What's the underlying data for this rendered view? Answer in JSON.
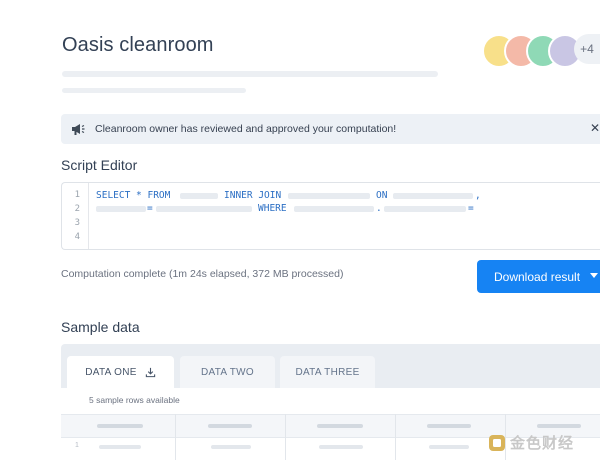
{
  "app": {
    "title": "Oasis cleanroom"
  },
  "collaborators": {
    "avatar_colors": [
      "#f8e08a",
      "#f4b9a8",
      "#8fd9b6",
      "#c9c6e4",
      "#b7dcc2"
    ],
    "extra_count": "+4"
  },
  "notice": {
    "icon": "megaphone-icon",
    "text": "Cleanroom owner has reviewed and approved your computation!",
    "close_glyph": "✕"
  },
  "script_editor": {
    "title": "Script Editor",
    "line_numbers": [
      "1",
      "2",
      "3",
      "4"
    ],
    "keywords": {
      "select": "SELECT * FROM",
      "inner_join": "INNER JOIN",
      "on": "ON",
      "comma": ",",
      "eq1": "=",
      "where": "WHERE",
      "dot": ".",
      "eq2": "="
    }
  },
  "computation": {
    "status": "Computation complete (1m 24s elapsed, 372 MB processed)",
    "download_label": "Download result"
  },
  "sample_data": {
    "title": "Sample data",
    "tabs": [
      {
        "label": "DATA ONE",
        "active": true,
        "icon": "download-icon"
      },
      {
        "label": "DATA TWO",
        "active": false
      },
      {
        "label": "DATA THREE",
        "active": false
      }
    ],
    "rows_note": "5 sample rows available",
    "first_row_number": "1"
  },
  "watermark": {
    "text": "金色财经"
  },
  "colors": {
    "accent": "#1683f3",
    "code_keyword": "#2c6fc4"
  }
}
